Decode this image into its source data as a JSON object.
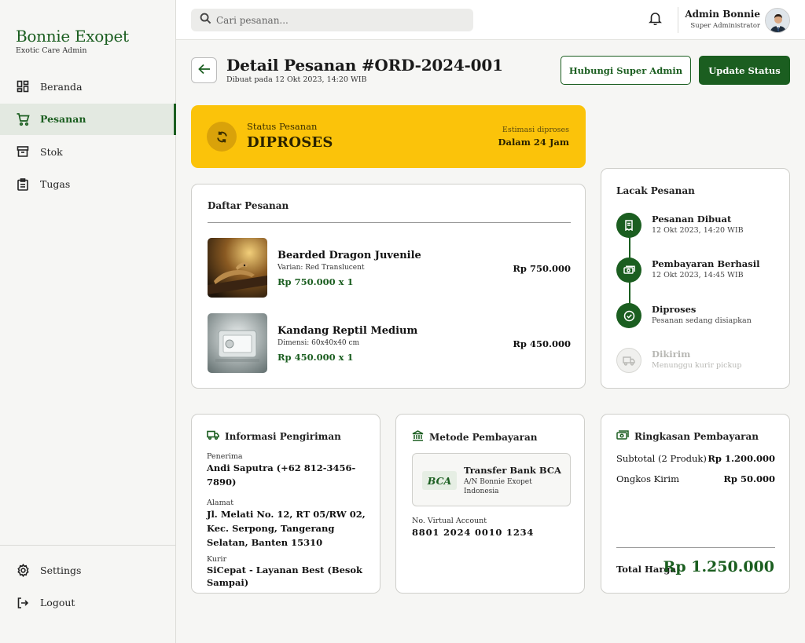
{
  "sidebar": {
    "brand_title": "Bonnie Exopet",
    "brand_subtitle": "Exotic Care Admin",
    "items": [
      {
        "label": "Beranda",
        "icon": "dashboard-icon"
      },
      {
        "label": "Pesanan",
        "icon": "cart-icon",
        "active": true
      },
      {
        "label": "Stok",
        "icon": "archive-icon"
      },
      {
        "label": "Tugas",
        "icon": "clipboard-icon"
      }
    ],
    "bottom": [
      {
        "label": "Settings",
        "icon": "gear-icon"
      },
      {
        "label": "Logout",
        "icon": "logout-icon"
      }
    ]
  },
  "topbar": {
    "search_placeholder": "Cari pesanan...",
    "user_name": "Admin Bonnie",
    "user_role": "Super Administrator"
  },
  "header": {
    "title": "Detail Pesanan #ORD-2024-001",
    "subtitle": "Dibuat pada 12 Okt 2023, 14:20 WIB",
    "contact_button": "Hubungi Super Admin",
    "update_button": "Update Status"
  },
  "status": {
    "label": "Status Pesanan",
    "value": "DIPROSES",
    "estimate_label": "Estimasi diproses",
    "estimate_value": "Dalam 24 Jam"
  },
  "orders": {
    "title": "Daftar Pesanan",
    "items": [
      {
        "name": "Bearded Dragon Juvenile",
        "variant": "Varian: Red Translucent",
        "qty_price": "Rp 750.000 x 1",
        "total": "Rp 750.000"
      },
      {
        "name": "Kandang Reptil Medium",
        "variant": "Dimensi: 60x40x40 cm",
        "qty_price": "Rp 450.000 x 1",
        "total": "Rp 450.000"
      }
    ]
  },
  "tracking": {
    "title": "Lacak Pesanan",
    "steps": [
      {
        "name": "Pesanan Dibuat",
        "detail": "12 Okt 2023, 14:20 WIB",
        "done": true
      },
      {
        "name": "Pembayaran Berhasil",
        "detail": "12 Okt 2023, 14:45 WIB",
        "done": true
      },
      {
        "name": "Diproses",
        "detail": "Pesanan sedang disiapkan",
        "done": true
      },
      {
        "name": "Dikirim",
        "detail": "Menunggu kurir pickup",
        "done": false
      }
    ]
  },
  "shipping": {
    "title": "Informasi Pengiriman",
    "recipient_label": "Penerima",
    "recipient": "Andi Saputra (+62 812-3456-7890)",
    "address_label": "Alamat",
    "address": "Jl. Melati No. 12, RT 05/RW 02, Kec. Serpong, Tangerang Selatan, Banten 15310",
    "courier_label": "Kurir",
    "courier": "SiCepat - Layanan Best (Besok Sampai)"
  },
  "payment": {
    "title": "Metode Pembayaran",
    "bank_logo": "BCA",
    "bank_name": "Transfer Bank BCA",
    "bank_owner": "A/N Bonnie Exopet Indonesia",
    "va_label": "No. Virtual Account",
    "va_number": "8801 2024 0010 1234"
  },
  "summary": {
    "title": "Ringkasan Pembayaran",
    "subtotal_label": "Subtotal (2 Produk)",
    "subtotal": "Rp 1.200.000",
    "shipping_label": "Ongkos Kirim",
    "shipping": "Rp 50.000",
    "total_label": "Total Harga",
    "total": "Rp 1.250.000"
  },
  "colors": {
    "primary": "#1b5e20",
    "status": "#fbc30a"
  }
}
